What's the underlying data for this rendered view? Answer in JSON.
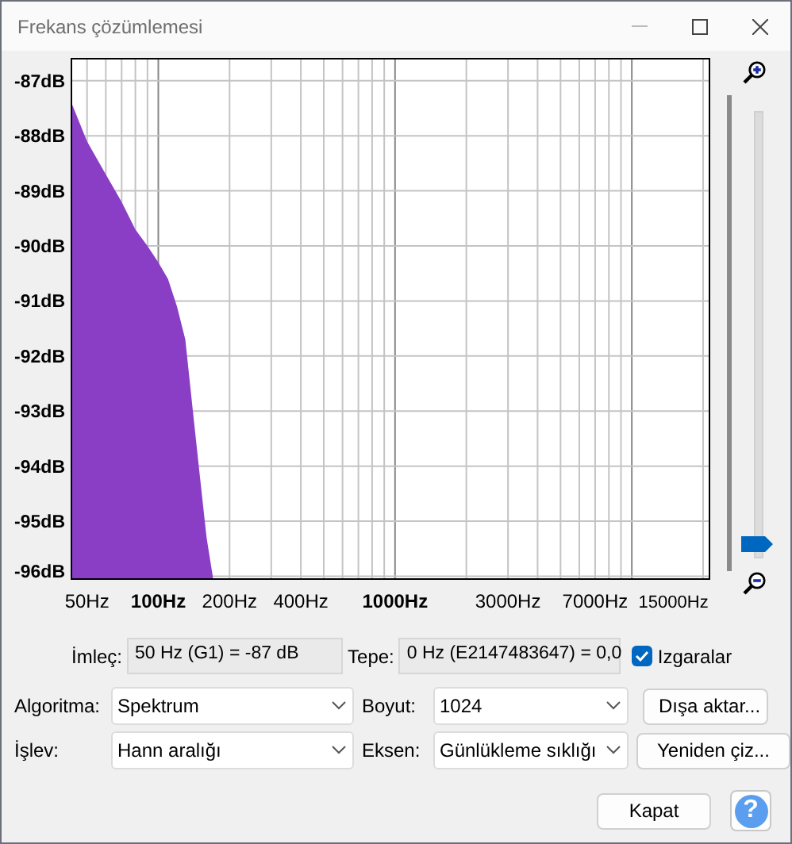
{
  "window": {
    "title": "Frekans çözümlemesi"
  },
  "chart": {
    "y_labels": [
      "-87dB",
      "-88dB",
      "-89dB",
      "-90dB",
      "-91dB",
      "-92dB",
      "-93dB",
      "-94dB",
      "-95dB",
      "-96dB"
    ],
    "x_labels": [
      {
        "text": "50Hz",
        "emphasized": false
      },
      {
        "text": "100Hz",
        "emphasized": true
      },
      {
        "text": "200Hz",
        "emphasized": false
      },
      {
        "text": "400Hz",
        "emphasized": false
      },
      {
        "text": "1000Hz",
        "emphasized": true
      },
      {
        "text": "3000Hz",
        "emphasized": false
      },
      {
        "text": "7000Hz",
        "emphasized": false
      },
      {
        "text": "15000Hz",
        "emphasized": false
      }
    ]
  },
  "zoom_slider": {
    "level": 0
  },
  "cursor": {
    "label": "İmleç:",
    "value": "50 Hz (G1) = -87 dB"
  },
  "peak": {
    "label": "Tepe:",
    "value": "0 Hz (E2147483647) = 0,0"
  },
  "grids": {
    "label": "Izgaralar",
    "checked": true
  },
  "algorithm": {
    "label": "Algoritma:",
    "value": "Spektrum"
  },
  "size": {
    "label": "Boyut:",
    "value": "1024"
  },
  "export_button": "Dışa aktar...",
  "function": {
    "label": "İşlev:",
    "value": "Hann aralığı"
  },
  "axis": {
    "label": "Eksen:",
    "value": "Günlükleme sıklığı"
  },
  "replot_button": "Yeniden çiz...",
  "close_button": "Kapat",
  "help_button": "?"
}
